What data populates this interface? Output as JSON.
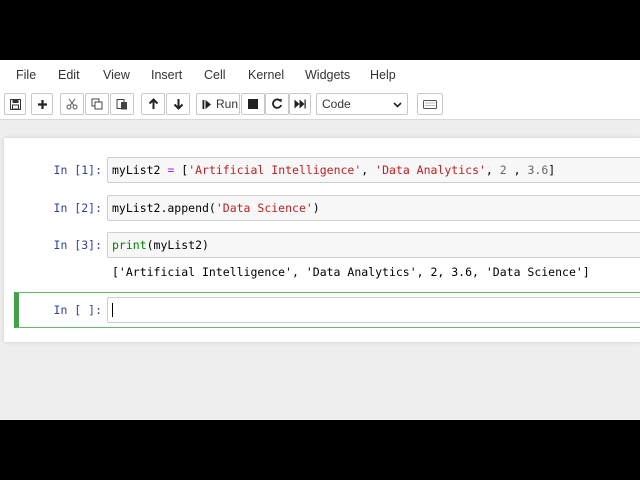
{
  "menu": [
    "File",
    "Edit",
    "View",
    "Insert",
    "Cell",
    "Kernel",
    "Widgets",
    "Help"
  ],
  "toolbar": {
    "run_label": "Run",
    "cell_type": "Code",
    "icons": [
      "save-icon",
      "plus-icon",
      "cut-icon",
      "copy-icon",
      "paste-icon",
      "arrow-up-icon",
      "arrow-down-icon",
      "step-forward-icon",
      "stop-icon",
      "restart-icon",
      "fast-forward-icon",
      "keyboard-icon"
    ]
  },
  "cells": [
    {
      "prompt": "In [1]:",
      "tokens": [
        {
          "t": "myList2",
          "c": "var"
        },
        {
          "t": " = ",
          "c": "op"
        },
        {
          "t": "[",
          "c": "var"
        },
        {
          "t": "'Artificial Intelligence'",
          "c": "str"
        },
        {
          "t": ", ",
          "c": "var"
        },
        {
          "t": "'Data Analytics'",
          "c": "str"
        },
        {
          "t": ", ",
          "c": "var"
        },
        {
          "t": "2",
          "c": "num"
        },
        {
          "t": " , ",
          "c": "var"
        },
        {
          "t": "3.6",
          "c": "num"
        },
        {
          "t": "]",
          "c": "var"
        }
      ]
    },
    {
      "prompt": "In [2]:",
      "tokens": [
        {
          "t": "myList2.append(",
          "c": "var"
        },
        {
          "t": "'Data Science'",
          "c": "str"
        },
        {
          "t": ")",
          "c": "var"
        }
      ]
    },
    {
      "prompt": "In [3]:",
      "tokens": [
        {
          "t": "print",
          "c": "func"
        },
        {
          "t": "(myList2)",
          "c": "var"
        }
      ],
      "output": "['Artificial Intelligence', 'Data Analytics', 2, 3.6, 'Data Science']"
    },
    {
      "prompt": "In [ ]:",
      "tokens": []
    }
  ],
  "colors": {
    "prompt": "#303f9f",
    "string": "#ba2121",
    "operator": "#aa22ff",
    "builtin": "#008000",
    "selected_border": "#43a047"
  }
}
